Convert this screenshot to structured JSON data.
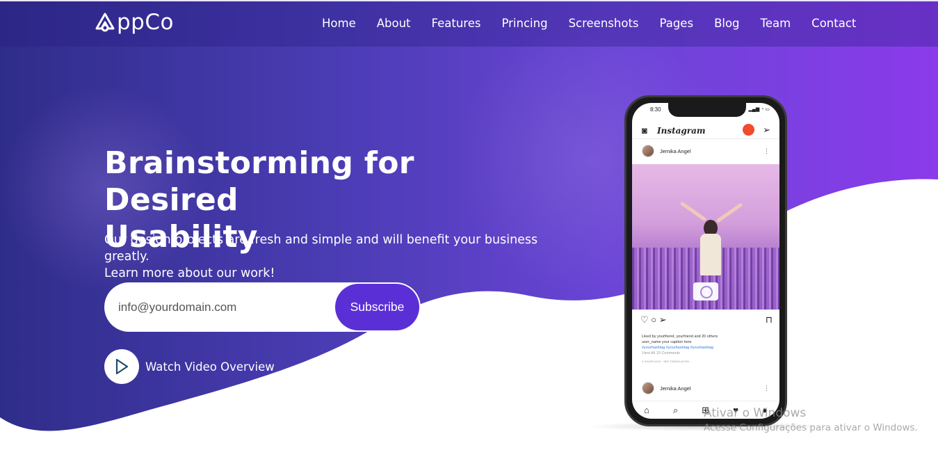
{
  "brand": {
    "name": "ppCo"
  },
  "nav": {
    "items": [
      {
        "label": "Home"
      },
      {
        "label": "About"
      },
      {
        "label": "Features"
      },
      {
        "label": "Princing"
      },
      {
        "label": "Screenshots"
      },
      {
        "label": "Pages"
      },
      {
        "label": "Blog"
      },
      {
        "label": "Team"
      },
      {
        "label": "Contact"
      }
    ]
  },
  "hero": {
    "title_line1": "Brainstorming for Desired",
    "title_line2": "Usability",
    "subtitle_line1": "Our design projects are fresh and simple and will benefit your business greatly.",
    "subtitle_line2": "Learn more about our work!",
    "subscribe": {
      "placeholder": "info@yourdomain.com",
      "button_label": "Subscribe"
    },
    "video_label": "Watch Video Overview"
  },
  "phone": {
    "status_time": "8:30",
    "app_name": "Instagram",
    "post_user": "Jemika Angel",
    "likes_text": "Liked by yourfriend, yourfriend and 20 others",
    "caption": "user_name  your caption here",
    "hashtags": "#yourhashtag #yourhashtag #yourhashtag",
    "comments": "View All 10 Comments",
    "meta": "2 HOURS AGO  ·  SEE TRANSLATION",
    "post2_user": "Jemika Angel"
  },
  "watermark": {
    "line1": "Ativar o Windows",
    "line2": "Acesse Configurações para ativar o Windows."
  },
  "colors": {
    "accent": "#5b2fd6",
    "gradient_start": "#2f2d8a",
    "gradient_end": "#8a3bea"
  }
}
